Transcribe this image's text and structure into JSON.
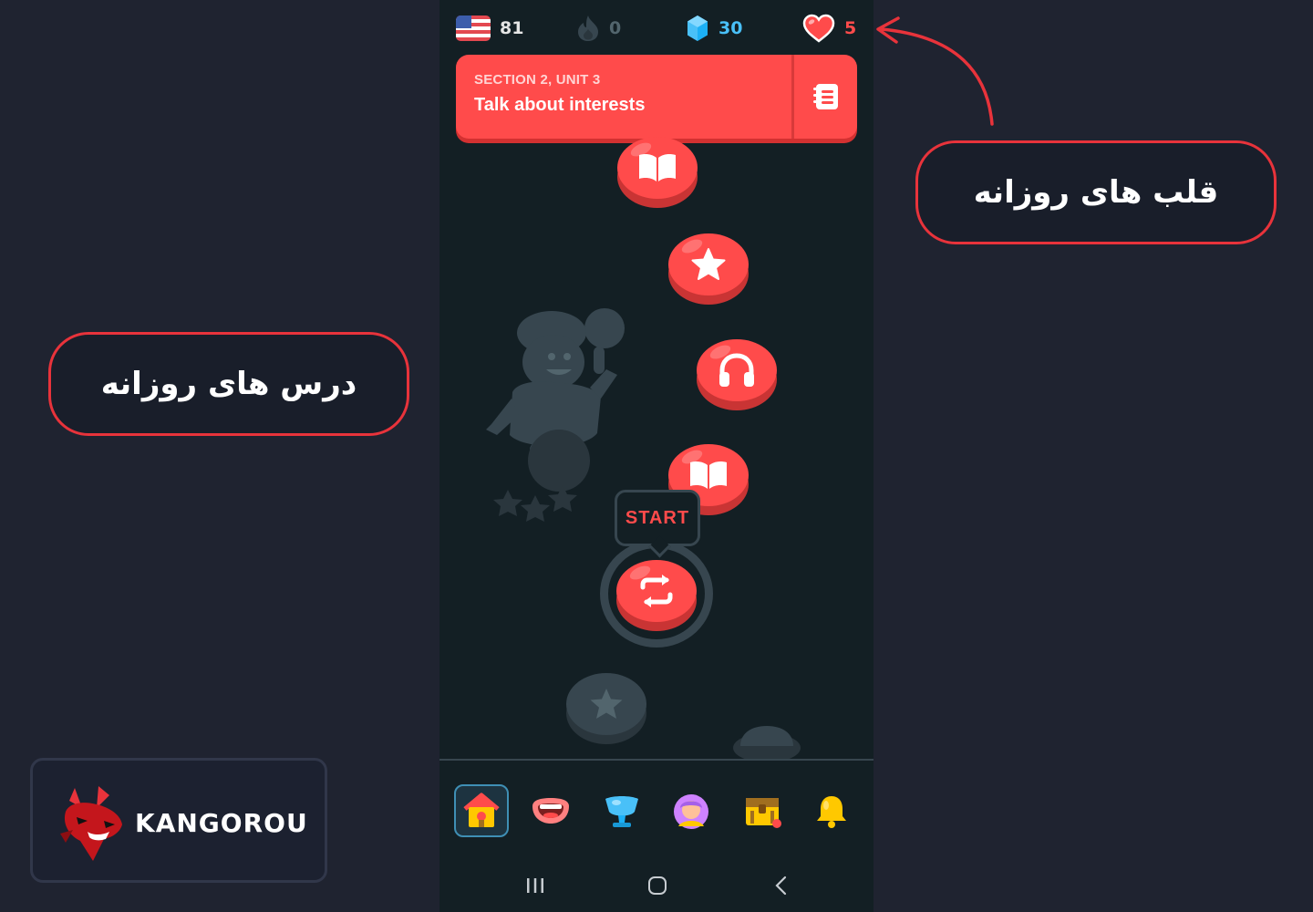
{
  "stats": {
    "flag_icon": "us-flag-icon",
    "courses_count": "81",
    "streak": "0",
    "gems": "30",
    "hearts": "5"
  },
  "unit": {
    "section_label": "SECTION 2, UNIT 3",
    "title": "Talk about interests"
  },
  "path": {
    "nodes": [
      {
        "icon": "book-icon",
        "state": "active"
      },
      {
        "icon": "star-icon",
        "state": "active"
      },
      {
        "icon": "headphones-icon",
        "state": "active"
      },
      {
        "icon": "book-icon",
        "state": "active"
      },
      {
        "icon": "practice-icon",
        "state": "current"
      },
      {
        "icon": "star-icon",
        "state": "locked"
      }
    ],
    "start_label": "START"
  },
  "nav": {
    "items": [
      "home-icon",
      "speak-icon",
      "league-icon",
      "profile-icon",
      "quests-chest-icon",
      "notifications-bell-icon"
    ],
    "active": "home-icon"
  },
  "annotations": {
    "hearts_label": "قلب های روزانه",
    "lessons_label": "درس های روزانه"
  },
  "logo": {
    "text": "KANGOROU"
  },
  "colors": {
    "accent": "#ff4b4b",
    "gem": "#49c0f8",
    "annotation_border": "#e8333b",
    "background": "#1f2330",
    "panel": "#131f24"
  }
}
